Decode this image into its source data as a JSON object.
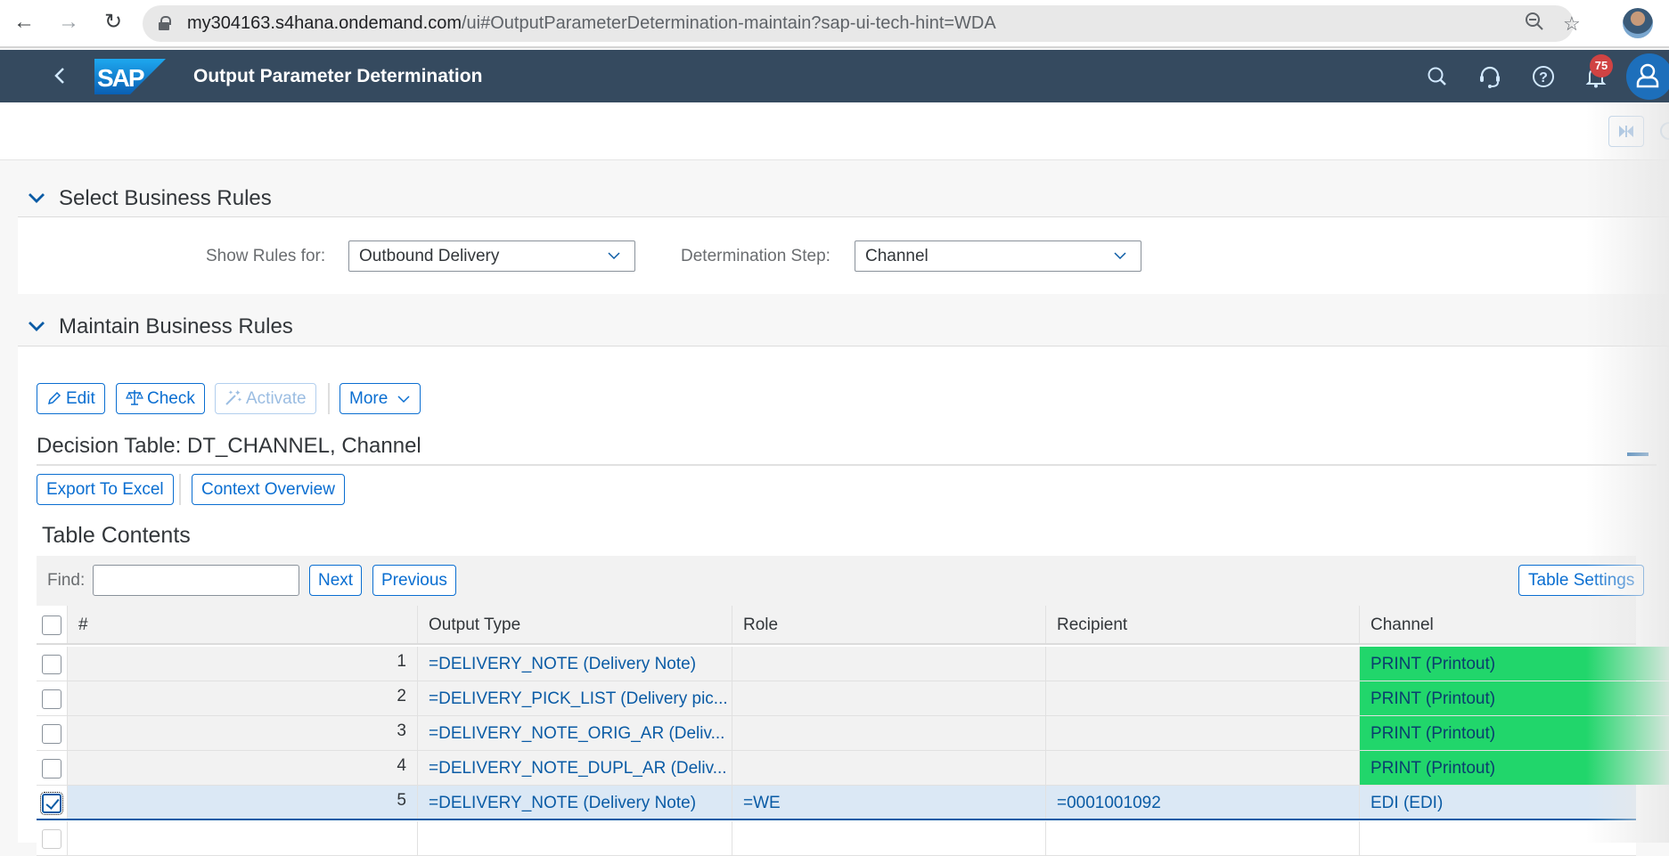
{
  "browser": {
    "url_host": "my304163.s4hana.ondemand.com",
    "url_path": "/ui#OutputParameterDetermination-maintain?sap-ui-tech-hint=WDA"
  },
  "shell": {
    "app_title": "Output Parameter Determination",
    "logo_text": "SAP",
    "notification_count": "75"
  },
  "select_section": {
    "title": "Select Business Rules",
    "show_rules_label": "Show Rules for:",
    "show_rules_value": "Outbound Delivery",
    "step_label": "Determination Step:",
    "step_value": "Channel"
  },
  "maintain_section": {
    "title": "Maintain Business Rules",
    "toolbar": {
      "edit": "Edit",
      "check": "Check",
      "activate": "Activate",
      "more": "More"
    },
    "decision_table_title": "Decision Table: DT_CHANNEL, Channel",
    "export_label": "Export To Excel",
    "context_label": "Context Overview",
    "table_contents_title": "Table Contents",
    "find_label": "Find:",
    "find_value": "",
    "next_label": "Next",
    "previous_label": "Previous",
    "table_settings_label": "Table Settings"
  },
  "table": {
    "columns": [
      "#",
      "Output Type",
      "Role",
      "Recipient",
      "Channel"
    ],
    "rows": [
      {
        "num": "1",
        "output_type": "=DELIVERY_NOTE (Delivery Note)",
        "role": "",
        "recipient": "",
        "channel": "PRINT (Printout)",
        "selected": false
      },
      {
        "num": "2",
        "output_type": "=DELIVERY_PICK_LIST (Delivery pic...",
        "role": "",
        "recipient": "",
        "channel": "PRINT (Printout)",
        "selected": false
      },
      {
        "num": "3",
        "output_type": "=DELIVERY_NOTE_ORIG_AR (Deliv...",
        "role": "",
        "recipient": "",
        "channel": "PRINT (Printout)",
        "selected": false
      },
      {
        "num": "4",
        "output_type": "=DELIVERY_NOTE_DUPL_AR (Deliv...",
        "role": "",
        "recipient": "",
        "channel": "PRINT (Printout)",
        "selected": false
      },
      {
        "num": "5",
        "output_type": "=DELIVERY_NOTE (Delivery Note)",
        "role": "=WE",
        "recipient": "=0001001092",
        "channel": "EDI (EDI)",
        "selected": true
      }
    ]
  },
  "colors": {
    "shell_bg": "#354a5f",
    "accent": "#0a6ed1",
    "highlight_green": "#21d66b",
    "selected_row": "#dbe8f5",
    "badge": "#d04343"
  }
}
